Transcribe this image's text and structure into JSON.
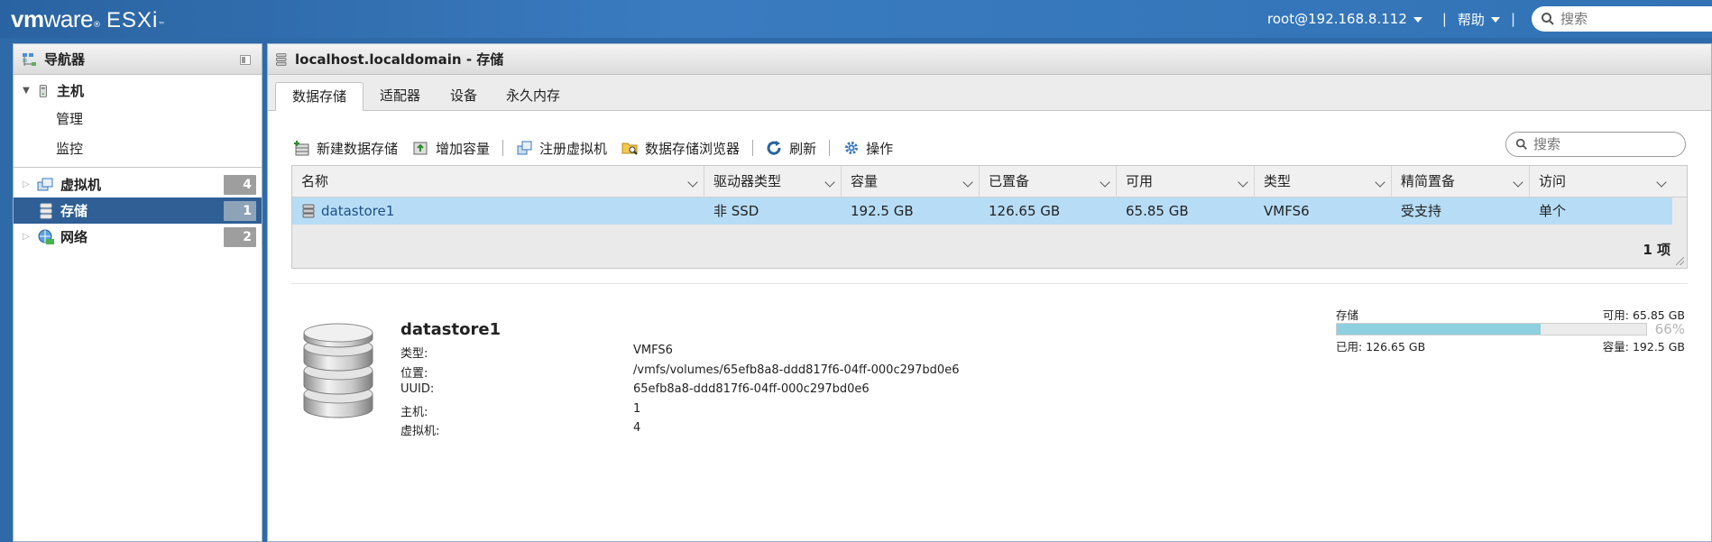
{
  "brand": {
    "vm": "vm",
    "ware": "ware",
    "reg": "®",
    "product": "ESXi",
    "tm": "™"
  },
  "topbar": {
    "user": "root@192.168.8.112",
    "help": "帮助",
    "sep": "|",
    "search_placeholder": "搜索"
  },
  "navigator": {
    "title": "导航器",
    "host": {
      "label": "主机",
      "children": [
        "管理",
        "监控"
      ]
    },
    "items": [
      {
        "label": "虚拟机",
        "count": "4"
      },
      {
        "label": "存储",
        "count": "1"
      },
      {
        "label": "网络",
        "count": "2"
      }
    ]
  },
  "main": {
    "title": "localhost.localdomain - 存储",
    "tabs": [
      "数据存储",
      "适配器",
      "设备",
      "永久内存"
    ],
    "toolbar": {
      "new_datastore": "新建数据存储",
      "increase_capacity": "增加容量",
      "register_vm": "注册虚拟机",
      "datastore_browser": "数据存储浏览器",
      "refresh": "刷新",
      "actions": "操作",
      "search_placeholder": "搜索"
    },
    "grid": {
      "columns": [
        "名称",
        "驱动器类型",
        "容量",
        "已置备",
        "可用",
        "类型",
        "精简置备",
        "访问"
      ],
      "rows": [
        [
          "datastore1",
          "非 SSD",
          "192.5 GB",
          "126.65 GB",
          "65.85 GB",
          "VMFS6",
          "受支持",
          "单个"
        ]
      ],
      "footer": "1 项"
    },
    "details": {
      "name": "datastore1",
      "props": [
        {
          "k": "类型:",
          "v": "VMFS6"
        },
        {
          "k": "位置:",
          "v": "/vmfs/volumes/65efb8a8-ddd817f6-04ff-000c297bd0e6"
        },
        {
          "k": "UUID:",
          "v": "65efb8a8-ddd817f6-04ff-000c297bd0e6"
        },
        {
          "k": "主机:",
          "v": "1"
        },
        {
          "k": "虚拟机:",
          "v": "4"
        }
      ],
      "storage": {
        "label": "存储",
        "free": "可用: 65.85 GB",
        "percent": "66%",
        "used": "已用: 126.65 GB",
        "capacity": "容量: 192.5 GB",
        "used_fraction": 0.66
      }
    }
  },
  "colors": {
    "accent": "#2f5f95",
    "selected_row": "#b7ddf6",
    "bar_fill": "#8ecfe0"
  }
}
